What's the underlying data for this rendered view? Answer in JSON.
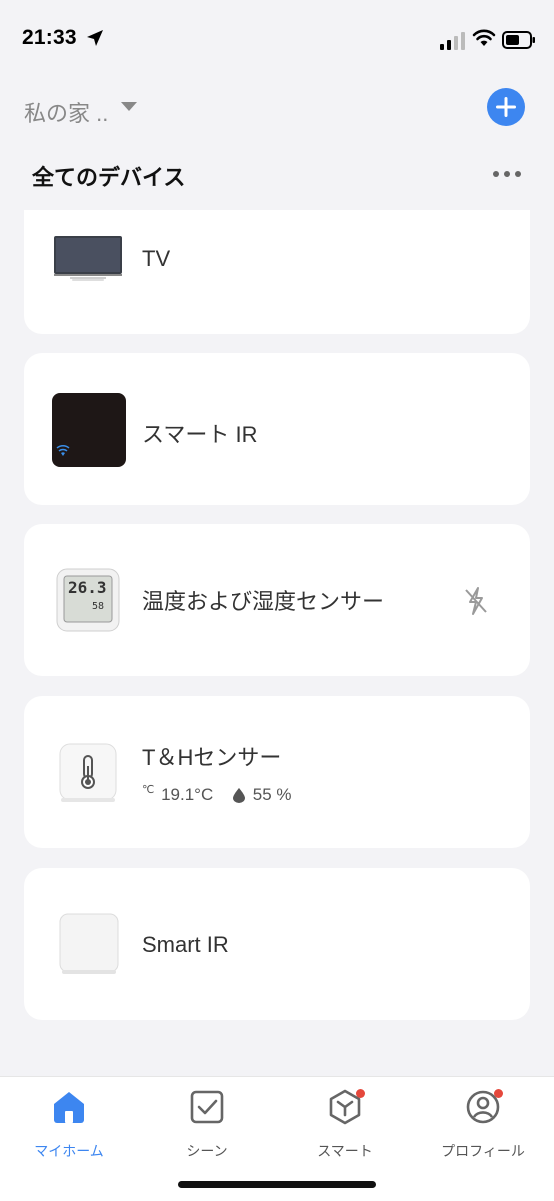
{
  "status_bar": {
    "time": "21:33"
  },
  "header": {
    "home_name": "私の家 ..",
    "section_title": "全てのデバイス"
  },
  "devices": [
    {
      "name": "TV",
      "thumb_icon": "tv-icon"
    },
    {
      "name": "スマート IR",
      "thumb_icon": "ir-hub-icon"
    },
    {
      "name": "温度および湿度センサー",
      "thumb_icon": "lcd-sensor-icon",
      "status_icon": "offline-icon",
      "lcd_temp": "26.3",
      "lcd_humidity": "58"
    },
    {
      "name": "T＆Hセンサー",
      "thumb_icon": "thermometer-icon",
      "temp_unit": "℃",
      "temperature": "19.1°C",
      "humidity": "55 %"
    },
    {
      "name": "Smart IR",
      "thumb_icon": "white-hub-icon"
    }
  ],
  "tabs": [
    {
      "label": "マイホーム",
      "icon": "home-icon",
      "active": true
    },
    {
      "label": "シーン",
      "icon": "check-square-icon"
    },
    {
      "label": "スマート",
      "icon": "cube-icon",
      "badge": true
    },
    {
      "label": "プロフィール",
      "icon": "profile-icon",
      "badge": true
    }
  ],
  "colors": {
    "accent": "#3d86f0",
    "background": "#f3f3f6",
    "badge": "#e5483c"
  }
}
